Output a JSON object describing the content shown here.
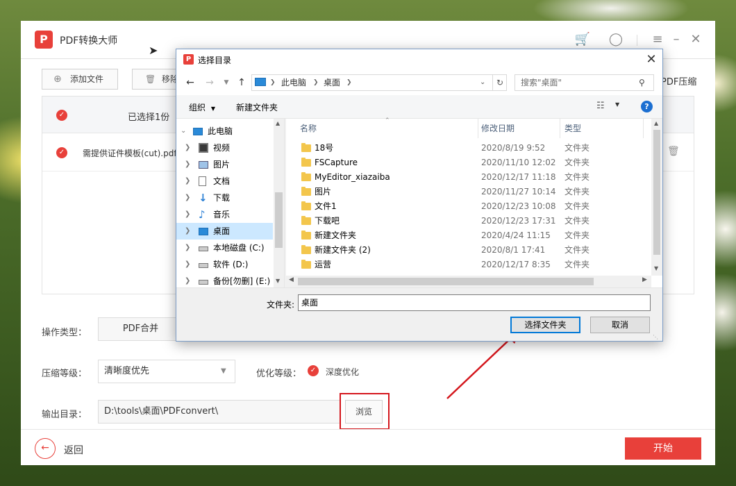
{
  "app": {
    "name": "PDF转换大师",
    "toolbar": {
      "add_file": "添加文件",
      "remove": "移除",
      "pdf_compress": "PDF压缩"
    },
    "list": {
      "header_selected": "已选择1份",
      "rows": [
        {
          "name": "需提供证件模板(cut).pdf"
        }
      ]
    },
    "form": {
      "op_type_label": "操作类型：",
      "op_type_value": "PDF合并",
      "compress_label": "压缩等级：",
      "compress_value": "清晰度优先",
      "optimize_label": "优化等级：",
      "optimize_value": "深度优化",
      "output_label": "输出目录：",
      "output_value": "D:\\tools\\桌面\\PDFconvert\\",
      "browse": "浏览"
    },
    "back": "返回",
    "start": "开始"
  },
  "dialog": {
    "title": "选择目录",
    "breadcrumb": [
      "此电脑",
      "桌面"
    ],
    "search_placeholder": "搜索\"桌面\"",
    "organize": "组织",
    "new_folder": "新建文件夹",
    "tree": [
      {
        "label": "此电脑",
        "icon": "computer-icon"
      },
      {
        "label": "视频",
        "icon": "video-icon"
      },
      {
        "label": "图片",
        "icon": "picture-icon"
      },
      {
        "label": "文档",
        "icon": "document-icon"
      },
      {
        "label": "下载",
        "icon": "download-icon"
      },
      {
        "label": "音乐",
        "icon": "music-icon"
      },
      {
        "label": "桌面",
        "icon": "desktop-icon"
      },
      {
        "label": "本地磁盘 (C:)",
        "icon": "drive-icon"
      },
      {
        "label": "软件 (D:)",
        "icon": "drive-icon"
      },
      {
        "label": "备份[勿删] (E:)",
        "icon": "drive-icon"
      }
    ],
    "columns": {
      "name": "名称",
      "modified": "修改日期",
      "type": "类型"
    },
    "files": [
      {
        "name": "18号",
        "date": "2020/8/19 9:52",
        "type": "文件夹"
      },
      {
        "name": "FSCapture",
        "date": "2020/11/10 12:02",
        "type": "文件夹"
      },
      {
        "name": "MyEditor_xiazaiba",
        "date": "2020/12/17 11:18",
        "type": "文件夹"
      },
      {
        "name": "图片",
        "date": "2020/11/27 10:14",
        "type": "文件夹"
      },
      {
        "name": "文件1",
        "date": "2020/12/23 10:08",
        "type": "文件夹"
      },
      {
        "name": "下载吧",
        "date": "2020/12/23 17:31",
        "type": "文件夹"
      },
      {
        "name": "新建文件夹",
        "date": "2020/4/24 11:15",
        "type": "文件夹"
      },
      {
        "name": "新建文件夹 (2)",
        "date": "2020/8/1 17:41",
        "type": "文件夹"
      },
      {
        "name": "运营",
        "date": "2020/12/17 8:35",
        "type": "文件夹"
      }
    ],
    "folder_label": "文件夹:",
    "folder_value": "桌面",
    "select_button": "选择文件夹",
    "cancel_button": "取消"
  },
  "colors": {
    "accent_red": "#e8403a",
    "annotation_red": "#d4161c",
    "win_blue": "#0078d7"
  }
}
